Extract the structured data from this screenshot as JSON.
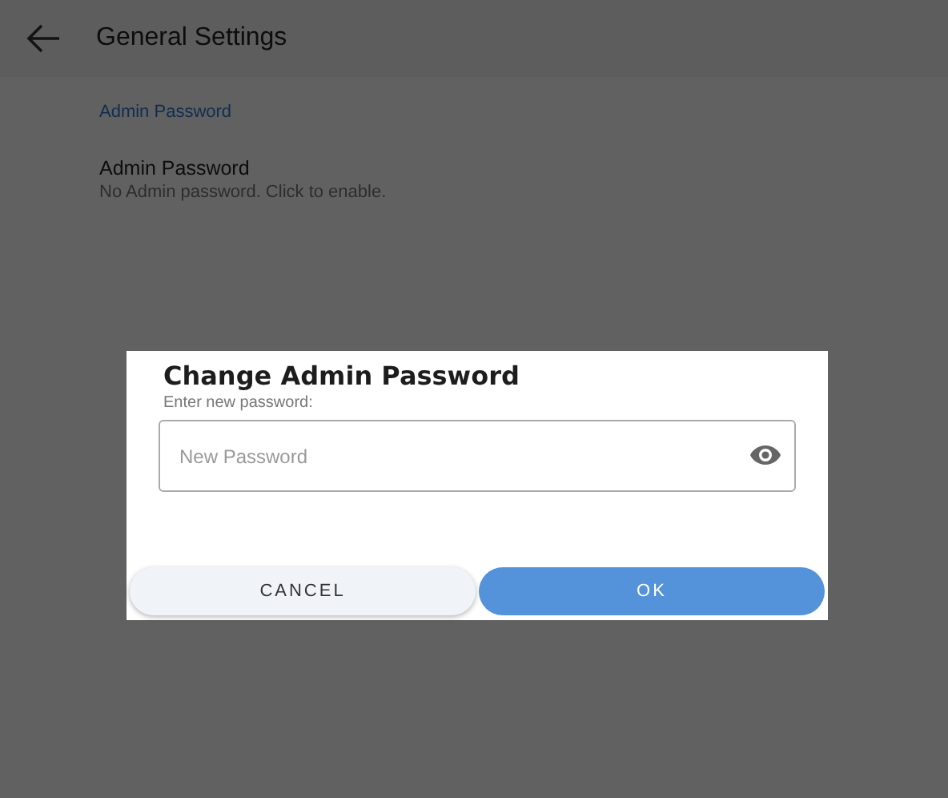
{
  "header": {
    "title": "General Settings"
  },
  "section": {
    "title": "Admin Password"
  },
  "settings": [
    {
      "title": "Admin Password",
      "summary": "No Admin password. Click to enable."
    }
  ],
  "dialog": {
    "title": "Change Admin Password",
    "prompt": "Enter new password:",
    "field": {
      "placeholder": "New Password"
    },
    "buttons": [
      {
        "label": "CANCEL",
        "kind": "secondary"
      },
      {
        "label": "OK",
        "kind": "primary"
      }
    ]
  }
}
